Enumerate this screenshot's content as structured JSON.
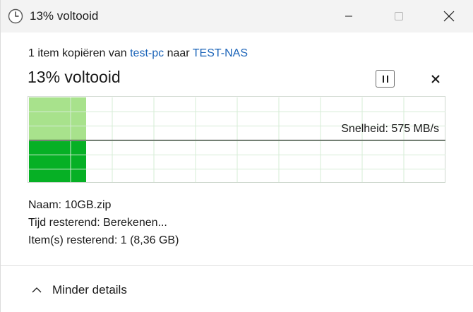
{
  "window": {
    "title": "13% voltooid"
  },
  "header": {
    "copy_prefix": "1 item kopiëren van",
    "source": "test-pc",
    "copy_middle": "naar",
    "destination": "TEST-NAS"
  },
  "status": {
    "title": "13% voltooid",
    "percent_complete": 13
  },
  "graph": {
    "speed_label": "Snelheid: 575 MB/s",
    "progress_fraction": 0.13,
    "colors": {
      "completed_top": "#a8e28c",
      "completed_bottom": "#06b025",
      "grid": "#d6ecd6",
      "speed_line": "#000000"
    }
  },
  "details": {
    "name_label": "Naam:",
    "name_value": "10GB.zip",
    "time_label": "Tijd resterend:",
    "time_value": "Berekenen...",
    "items_label": "Item(s) resterend:",
    "items_value": "1 (8,36 GB)"
  },
  "footer": {
    "less_details_label": "Minder details"
  },
  "icons": {
    "app": "clock-icon",
    "pause": "pause-icon",
    "cancel": "close-icon",
    "chevron": "chevron-up-icon"
  }
}
